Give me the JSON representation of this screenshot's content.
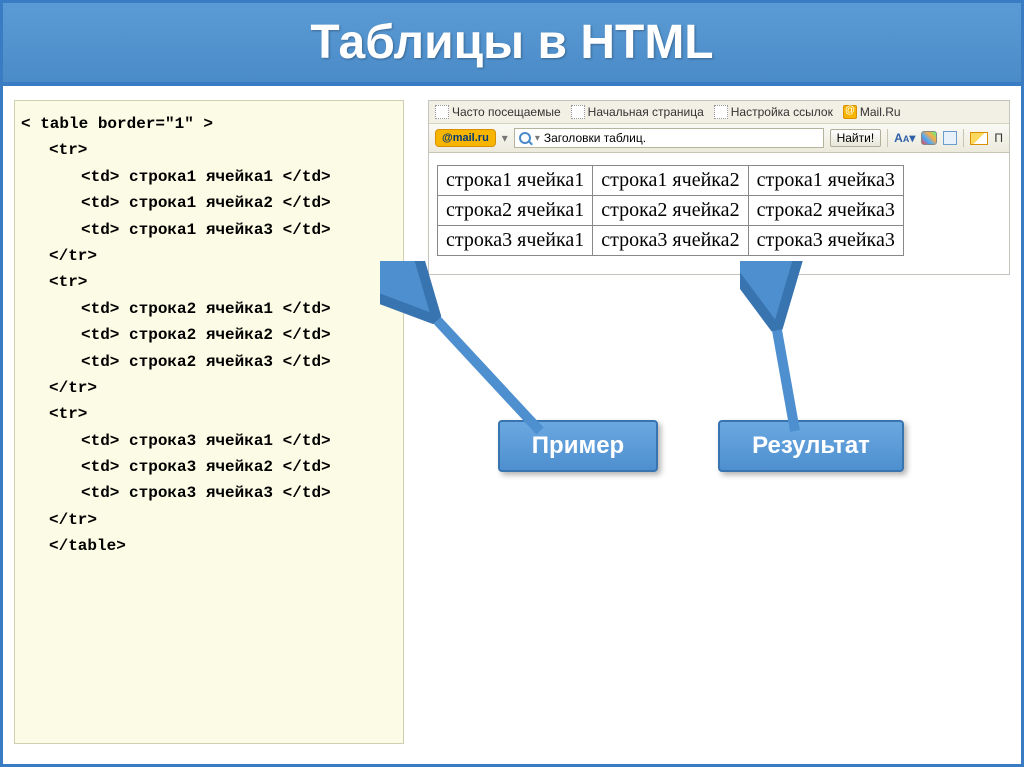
{
  "title": "Таблицы в HTML",
  "code_lines": [
    {
      "indent": "",
      "text": "< table border=\"1\" >"
    },
    {
      "indent": "i1",
      "text": "<tr>"
    },
    {
      "indent": "i2",
      "text": "<td> строка1 ячейка1 </td>"
    },
    {
      "indent": "i2",
      "text": "<td> строка1 ячейка2 </td>"
    },
    {
      "indent": "i2",
      "text": "<td> строка1 ячейка3 </td>"
    },
    {
      "indent": "i1",
      "text": "</tr>"
    },
    {
      "indent": "i1",
      "text": "<tr>"
    },
    {
      "indent": "i2",
      "text": "<td> строка2 ячейка1 </td>"
    },
    {
      "indent": "i2",
      "text": "<td> строка2 ячейка2 </td>"
    },
    {
      "indent": "i2",
      "text": "<td> строка2 ячейка3 </td>"
    },
    {
      "indent": "i1",
      "text": "</tr>"
    },
    {
      "indent": "i1",
      "text": "<tr>"
    },
    {
      "indent": "i2",
      "text": "<td> строка3 ячейка1 </td>"
    },
    {
      "indent": "i2",
      "text": "<td> строка3 ячейка2 </td>"
    },
    {
      "indent": "i2",
      "text": "<td> строка3 ячейка3 </td>"
    },
    {
      "indent": "i1",
      "text": "</tr>"
    },
    {
      "indent": "i1",
      "text": "</table>"
    }
  ],
  "browser": {
    "bookmarks": {
      "frequent": "Часто посещаемые",
      "homepage": "Начальная страница",
      "links_settings": "Настройка ссылок",
      "mailru": "Mail.Ru"
    },
    "toolbar": {
      "logo": "@mail.ru",
      "search_text": "Заголовки таблиц.",
      "find": "Найти!",
      "mail_prefix": "П"
    }
  },
  "result_table": {
    "rows": [
      [
        "строка1 ячейка1",
        "строка1 ячейка2",
        "строка1 ячейка3"
      ],
      [
        "строка2 ячейка1",
        "строка2 ячейка2",
        "строка2 ячейка3"
      ],
      [
        "строка3 ячейка1",
        "строка3 ячейка2",
        "строка3 ячейка3"
      ]
    ]
  },
  "callouts": {
    "example": "Пример",
    "result": "Результат"
  }
}
